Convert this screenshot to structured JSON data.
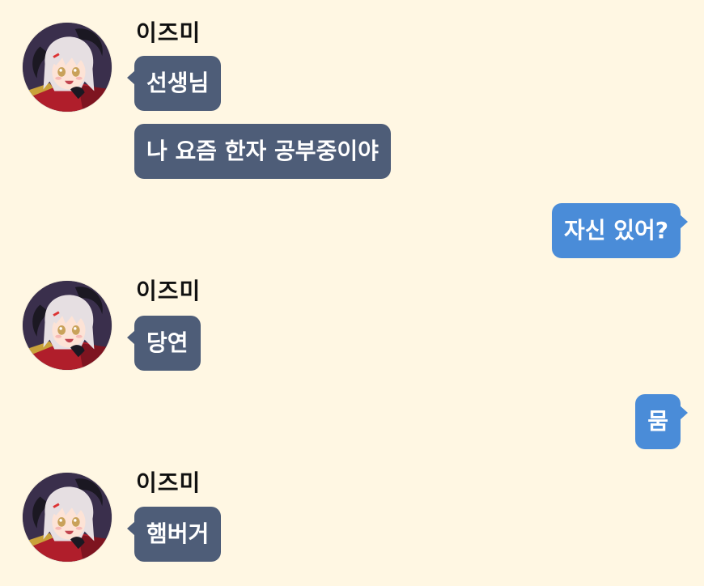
{
  "colors": {
    "background": "#FFF7E3",
    "incoming_bubble": "#4E5D78",
    "outgoing_bubble": "#4A8CD8",
    "bubble_text": "#FFFFFF",
    "name_text": "#111111"
  },
  "messages": [
    {
      "type": "in",
      "sender": "이즈미",
      "avatar": "izumi-avatar-icon",
      "texts": [
        "선생님",
        "나 요즘 한자 공부중이야"
      ]
    },
    {
      "type": "out",
      "texts": [
        "자신 있어?"
      ]
    },
    {
      "type": "in",
      "sender": "이즈미",
      "avatar": "izumi-avatar-icon",
      "texts": [
        "당연"
      ]
    },
    {
      "type": "out",
      "texts": [
        "뭄"
      ]
    },
    {
      "type": "in",
      "sender": "이즈미",
      "avatar": "izumi-avatar-icon",
      "texts": [
        "햄버거"
      ]
    }
  ]
}
